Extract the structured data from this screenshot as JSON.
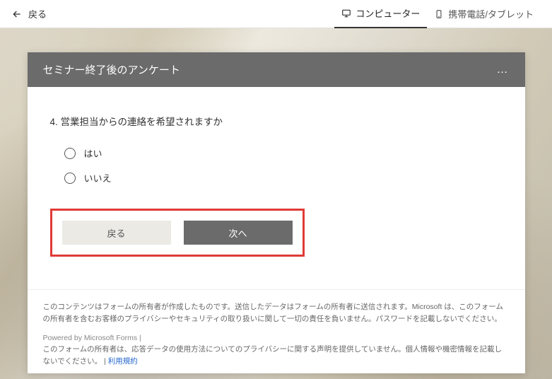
{
  "topbar": {
    "back_label": "戻る",
    "tab_computer": "コンピューター",
    "tab_mobile": "携帯電話/タブレット"
  },
  "form": {
    "title": "セミナー終了後のアンケート",
    "question": "4. 営業担当からの連絡を希望されますか",
    "options": [
      "はい",
      "いいえ"
    ],
    "prev_btn": "戻る",
    "next_btn": "次へ"
  },
  "footer": {
    "disclaimer": "このコンテンツはフォームの所有者が作成したものです。送信したデータはフォームの所有者に送信されます。Microsoft は、このフォームの所有者を含むお客様のプライバシーやセキュリティの取り扱いに関して一切の責任を負いません。パスワードを記載しないでください。",
    "powered": "Powered by Microsoft Forms",
    "separator": " | ",
    "privacy_note": "このフォームの所有者は、応答データの使用方法についてのプライバシーに関する声明を提供していません。個人情報や機密情報を記載しないでください。",
    "terms_label": "利用規約"
  }
}
